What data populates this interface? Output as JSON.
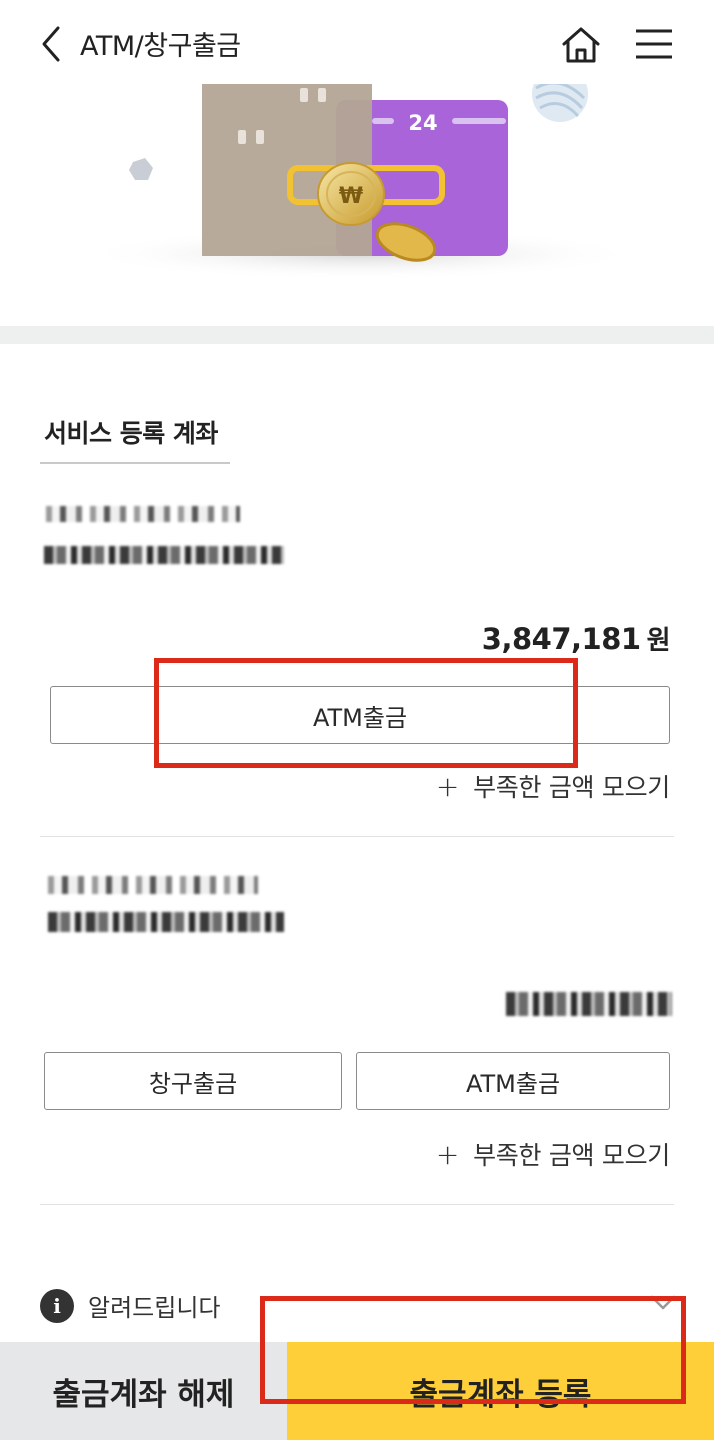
{
  "header": {
    "title": "ATM/창구출금",
    "back_icon": "chevron-left-icon",
    "home_icon": "home-icon",
    "menu_icon": "hamburger-menu-icon"
  },
  "banner": {
    "calendar_number": "24",
    "coin_symbol": "₩"
  },
  "section": {
    "title": "서비스 등록 계좌"
  },
  "accounts": [
    {
      "amount": "3,847,181",
      "currency": "원",
      "buttons": [
        "ATM출금"
      ],
      "gather_label": "부족한 금액 모으기"
    },
    {
      "buttons": [
        "창구출금",
        "ATM출금"
      ],
      "gather_label": "부족한 금액 모으기"
    }
  ],
  "notice": {
    "label": "알려드립니다",
    "icon": "info-icon"
  },
  "bottom": {
    "left_label": "출금계좌 해제",
    "right_label": "출금계좌 등록"
  },
  "colors": {
    "accent_yellow": "#ffcf3a",
    "highlight_red": "#dc2a1a",
    "card_purple": "#a864d8"
  }
}
